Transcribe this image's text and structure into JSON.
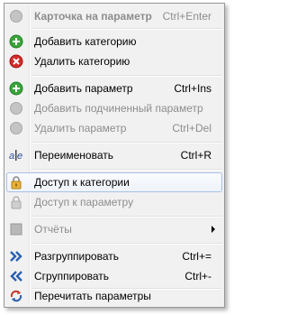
{
  "menu": {
    "items": [
      {
        "label": "Карточка на параметр",
        "shortcut": "Ctrl+Enter",
        "icon": "disabled-circle-icon"
      },
      {
        "label": "Добавить категорию",
        "shortcut": "",
        "icon": "green-plus-icon"
      },
      {
        "label": "Удалить категорию",
        "shortcut": "",
        "icon": "red-x-icon"
      },
      {
        "label": "Добавить параметр",
        "shortcut": "Ctrl+Ins",
        "icon": "green-plus-icon"
      },
      {
        "label": "Добавить подчиненный параметр",
        "shortcut": "",
        "icon": "disabled-circle-icon"
      },
      {
        "label": "Удалить параметр",
        "shortcut": "Ctrl+Del",
        "icon": "disabled-circle-icon"
      },
      {
        "label": "Переименовать",
        "shortcut": "Ctrl+R",
        "icon": "rename-icon"
      },
      {
        "label": "Доступ к категории",
        "shortcut": "",
        "icon": "lock-icon"
      },
      {
        "label": "Доступ к параметру",
        "shortcut": "",
        "icon": "lock-disabled-icon"
      },
      {
        "label": "Отчёты",
        "shortcut": "",
        "icon": "reports-icon"
      },
      {
        "label": "Разгруппировать",
        "shortcut": "Ctrl+=",
        "icon": "ungroup-icon"
      },
      {
        "label": "Сгруппировать",
        "shortcut": "Ctrl+-",
        "icon": "group-icon"
      },
      {
        "label": "Перечитать параметры",
        "shortcut": "",
        "icon": "refresh-icon"
      }
    ]
  },
  "colors": {
    "menu_bg": "#f1f1f1",
    "disabled_text": "#8d8d8d",
    "highlight_border": "#a8c2e6",
    "plus_green": "#3aa43a",
    "delete_red": "#d42a2a",
    "arrow_blue": "#2a5fb0"
  }
}
